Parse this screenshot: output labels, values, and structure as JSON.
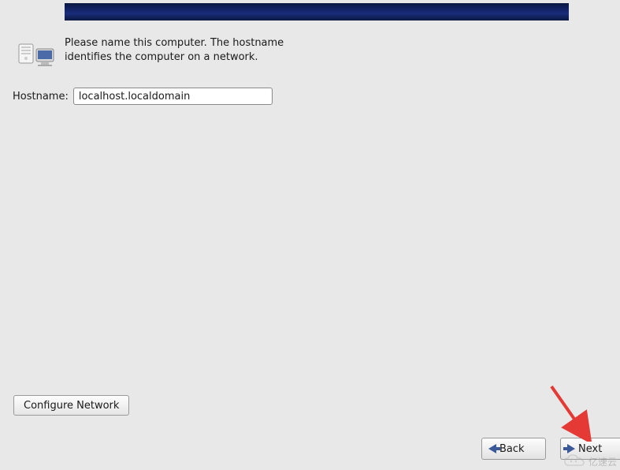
{
  "info": {
    "description": "Please name this computer.  The hostname identifies the computer on a network."
  },
  "hostname": {
    "label": "Hostname:",
    "value": "localhost.localdomain"
  },
  "buttons": {
    "configure_network": "Configure Network",
    "back": "Back",
    "next": "Next"
  },
  "watermark": {
    "text": "亿速云"
  }
}
